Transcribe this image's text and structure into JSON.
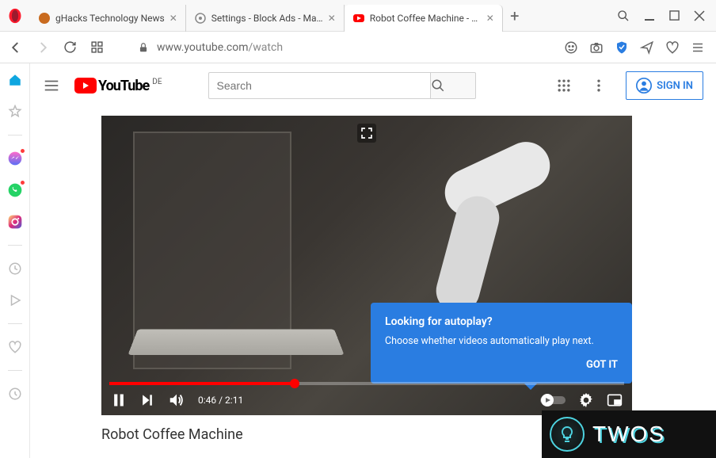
{
  "window": {
    "tabs": [
      {
        "title": "gHacks Technology News",
        "active": false
      },
      {
        "title": "Settings - Block Ads - Man…",
        "active": false
      },
      {
        "title": "Robot Coffee Machine - Yo…",
        "active": true
      }
    ]
  },
  "url": {
    "domain": "www.youtube.com",
    "path": "/watch"
  },
  "youtube": {
    "brand": "YouTube",
    "region": "DE",
    "search_placeholder": "Search",
    "signin": "SIGN IN"
  },
  "player": {
    "time_current": "0:46",
    "time_total": "2:11",
    "progress_pct": 36
  },
  "tooltip": {
    "title": "Looking for autoplay?",
    "body": "Choose whether videos automatically play next.",
    "action": "GOT IT"
  },
  "video": {
    "title": "Robot Coffee Machine"
  },
  "watermark": {
    "text": "TWOS"
  }
}
